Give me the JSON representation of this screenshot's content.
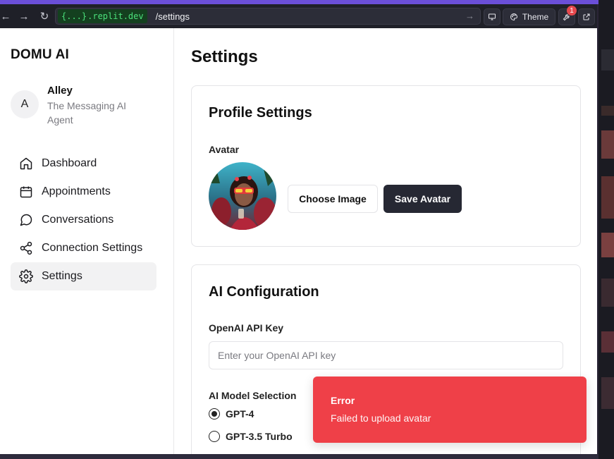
{
  "browser": {
    "url_chip_braces": "{...}",
    "url_chip_domain": ".replit.dev",
    "url_path": "/settings",
    "theme_label": "Theme",
    "notification_count": "1"
  },
  "sidebar": {
    "brand": "DOMU AI",
    "profile": {
      "initial": "A",
      "name": "Alley",
      "role": "The Messaging AI Agent"
    },
    "items": [
      {
        "label": "Dashboard",
        "icon": "home-icon",
        "active": false
      },
      {
        "label": "Appointments",
        "icon": "calendar-icon",
        "active": false
      },
      {
        "label": "Conversations",
        "icon": "chat-bubble-icon",
        "active": false
      },
      {
        "label": "Connection Settings",
        "icon": "share-icon",
        "active": false
      },
      {
        "label": "Settings",
        "icon": "gear-icon",
        "active": true
      }
    ]
  },
  "main": {
    "title": "Settings",
    "profile_card": {
      "title": "Profile Settings",
      "avatar_label": "Avatar",
      "choose_label": "Choose Image",
      "save_label": "Save Avatar"
    },
    "ai_card": {
      "title": "AI Configuration",
      "api_key_label": "OpenAI API Key",
      "api_key_value": "",
      "api_key_placeholder": "Enter your OpenAI API key",
      "model_label": "AI Model Selection",
      "models": [
        {
          "label": "GPT-4",
          "selected": true
        },
        {
          "label": "GPT-3.5 Turbo",
          "selected": false
        }
      ]
    }
  },
  "toast": {
    "title": "Error",
    "message": "Failed to upload avatar"
  },
  "colors": {
    "accent_frame": "#6b4fd8",
    "toast_bg": "#ef4048",
    "primary_button": "#262833",
    "url_chip_green": "#4be07b"
  }
}
